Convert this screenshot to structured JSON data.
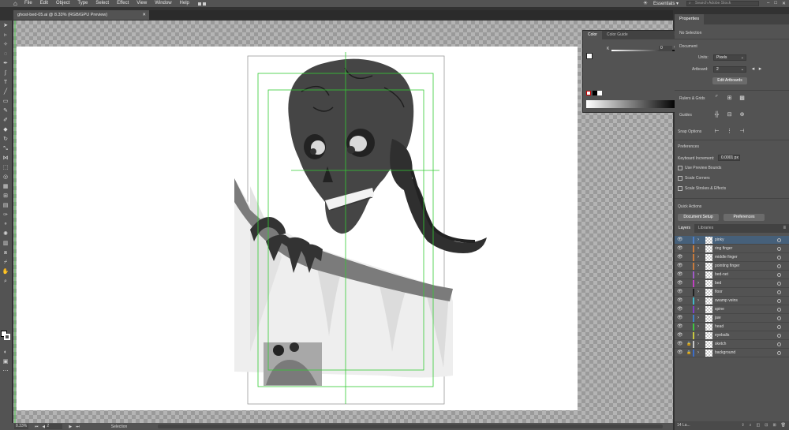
{
  "app": {
    "logo": "Ai"
  },
  "menu": [
    "File",
    "Edit",
    "Object",
    "Type",
    "Select",
    "Effect",
    "View",
    "Window",
    "Help"
  ],
  "header": {
    "workspace": "Essentials ▾",
    "search_placeholder": "Search Adobe Stock"
  },
  "document": {
    "tab_title": "ghost-bed-05.ai @ 8.33% (RGB/GPU Preview)"
  },
  "status": {
    "zoom": "8.33%",
    "artboard": "2",
    "mode": "Selection"
  },
  "color_panel": {
    "tab_color": "Color",
    "tab_guide": "Color Guide",
    "k_label": "K",
    "k_value": "0",
    "pct": "%"
  },
  "properties": {
    "tab": "Properties",
    "no_selection": "No Selection",
    "document_label": "Document",
    "units_label": "Units:",
    "units_value": "Pixels",
    "artboard_label": "Artboard:",
    "artboard_value": "2",
    "edit_artboards": "Edit Artboards",
    "rulers_label": "Rulers & Grids",
    "guides_label": "Guides",
    "snap_label": "Snap Options",
    "prefs_label": "Preferences",
    "kb_label": "Keyboard Increment:",
    "kb_value": "0.0001 px",
    "opt1": "Use Preview Bounds",
    "opt2": "Scale Corners",
    "opt3": "Scale Strokes & Effects",
    "quick_actions": "Quick Actions",
    "doc_setup": "Document Setup",
    "preferences_btn": "Preferences"
  },
  "layers_panel": {
    "tab_layers": "Layers",
    "tab_libraries": "Libraries",
    "footer": "14 La...",
    "layers": [
      {
        "name": "pinky",
        "color": "#4f7fc4",
        "selected": true,
        "locked": false
      },
      {
        "name": "ring finger",
        "color": "#c87a3c",
        "selected": false,
        "locked": false
      },
      {
        "name": "middle finger",
        "color": "#c87a3c",
        "selected": false,
        "locked": false
      },
      {
        "name": "pointing finger",
        "color": "#c87a3c",
        "selected": false,
        "locked": false
      },
      {
        "name": "bed-net",
        "color": "#a05ac8",
        "selected": false,
        "locked": false
      },
      {
        "name": "bed",
        "color": "#c040c0",
        "selected": false,
        "locked": false
      },
      {
        "name": "floor",
        "color": "#222222",
        "selected": false,
        "locked": false
      },
      {
        "name": "swamp veins",
        "color": "#40b8c8",
        "selected": false,
        "locked": false
      },
      {
        "name": "spine",
        "color": "#8040c8",
        "selected": false,
        "locked": false
      },
      {
        "name": "jaw",
        "color": "#4080c8",
        "selected": false,
        "locked": false
      },
      {
        "name": "head",
        "color": "#40c840",
        "selected": false,
        "locked": false
      },
      {
        "name": "eyeballs",
        "color": "#c8c840",
        "selected": false,
        "locked": false
      },
      {
        "name": "sketch",
        "color": "#c8c8c8",
        "selected": false,
        "locked": true
      },
      {
        "name": "background",
        "color": "#3c6ec8",
        "selected": false,
        "locked": true
      }
    ]
  }
}
